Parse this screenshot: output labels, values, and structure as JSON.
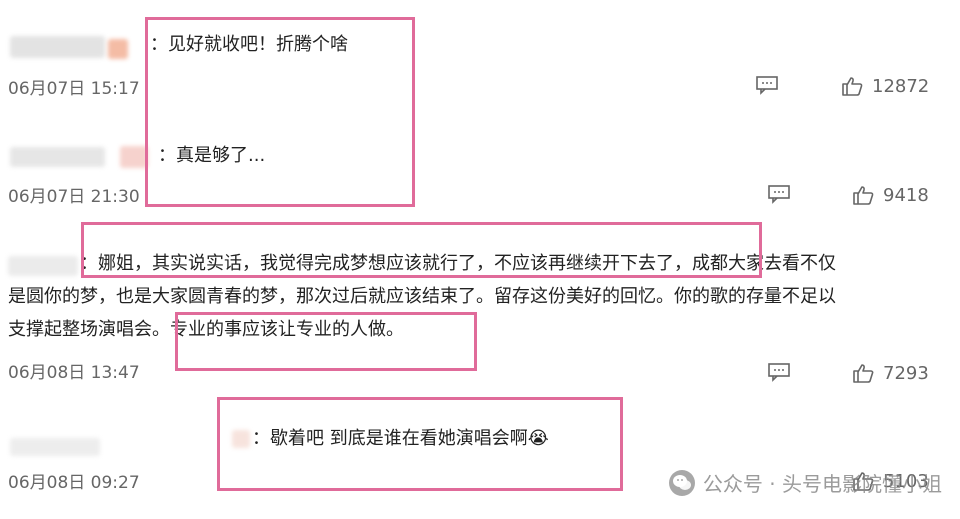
{
  "comments": [
    {
      "text_lines": [
        "：见好就收吧！折腾个啥"
      ],
      "time": "06月07日 15:17",
      "likes": "12872"
    },
    {
      "text_lines": [
        "：真是够了..."
      ],
      "time": "06月07日 21:30",
      "likes": "9418"
    },
    {
      "text_lines": [
        "：娜姐，其实说实话，我觉得完成梦想应该就行了，不应该再继续开下去了，成都大家去看不仅",
        "是圆你的梦，也是大家圆青春的梦，那次过后就应该结束了。留存这份美好的回忆。你的歌的存量不足以",
        "支撑起整场演唱会。专业的事应该让专业的人做。"
      ],
      "time": "06月08日 13:47",
      "likes": "7293"
    },
    {
      "text_lines": [
        "：歇着吧 到底是谁在看她演唱会啊😭"
      ],
      "time": "06月08日 09:27",
      "likes": "5103"
    }
  ],
  "watermark": {
    "label": "公众号 · 头号电影院懂小姐"
  },
  "icons": {
    "comment": "comment-icon",
    "like": "thumbs-up-icon",
    "watermark_logo": "wechat-logo-icon"
  },
  "colors": {
    "highlight": "#e06b9a",
    "text": "#222222",
    "meta": "#666666"
  }
}
